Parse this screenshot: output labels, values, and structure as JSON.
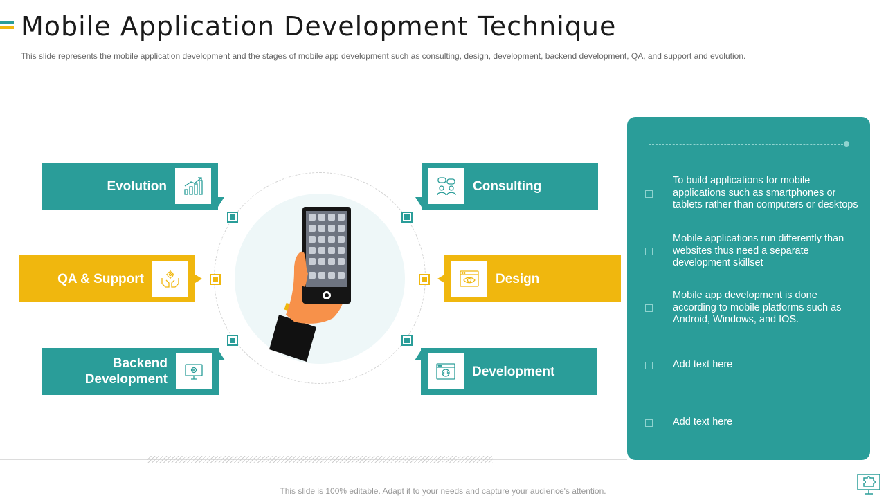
{
  "header": {
    "title": "Mobile Application Development Technique",
    "subtitle": "This slide represents the mobile application development  and the stages of mobile app development  such as consulting, design, development,  backend development,  QA, and support and evolution."
  },
  "stages": {
    "evolution": {
      "label": "Evolution",
      "icon": "growth-chart-icon"
    },
    "qa_support": {
      "label": "QA & Support",
      "icon": "hands-gear-icon"
    },
    "backend": {
      "label": "Backend\nDevelopment",
      "icon": "monitor-gear-icon"
    },
    "consulting": {
      "label": "Consulting",
      "icon": "people-chat-icon"
    },
    "design": {
      "label": "Design",
      "icon": "browser-eye-icon"
    },
    "development": {
      "label": "Development",
      "icon": "browser-code-gear-icon"
    }
  },
  "panel": {
    "items": [
      "To build applications for mobile applications such as smartphones or tablets rather than computers or desktops",
      "Mobile applications run differently than websites thus need a separate development skillset",
      "Mobile app development is done according to mobile platforms such as Android,  Windows, and IOS.",
      "Add text here",
      "Add text here"
    ]
  },
  "footer": {
    "text": "This slide is 100% editable. Adapt it to your needs and capture your audience's attention."
  },
  "colors": {
    "teal": "#2a9d99",
    "yellow": "#f0b70e",
    "light_teal_circle": "#eef7f8"
  },
  "icons": {
    "center_illustration": "hand-holding-phone-icon",
    "corner": "monitor-puzzle-icon"
  }
}
